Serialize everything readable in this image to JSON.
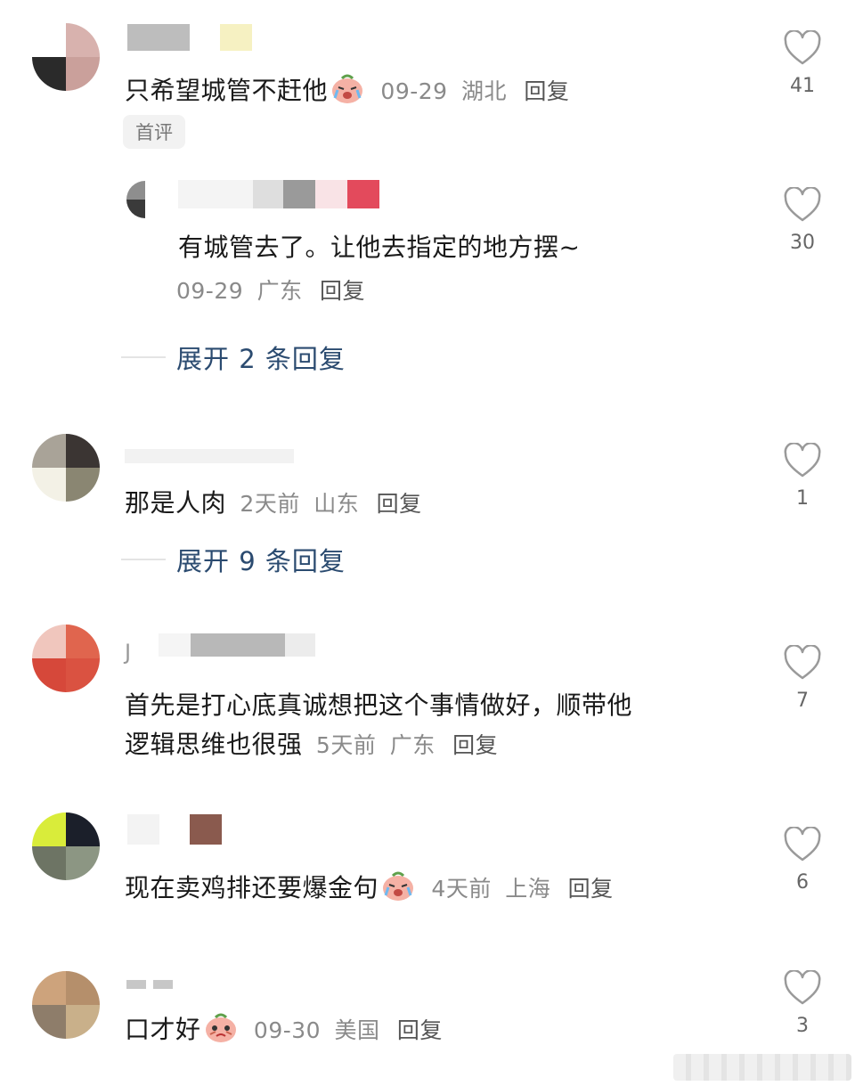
{
  "comments": [
    {
      "text": "只希望城管不赶他",
      "date": "09-29",
      "location": "湖北",
      "reply": "回复",
      "badge": "首评",
      "likes": "41",
      "emoji": "crying-face-icon"
    },
    {
      "text": "有城管去了。让他去指定的地方摆~",
      "date": "09-29",
      "location": "广东",
      "reply": "回复",
      "likes": "30",
      "expand": "展开 2 条回复"
    },
    {
      "text": "那是人肉",
      "date": "2天前",
      "location": "山东",
      "reply": "回复",
      "likes": "1",
      "expand": "展开 9 条回复"
    },
    {
      "author": "J",
      "text_line1": "首先是打心底真诚想把这个事情做好，顺带他",
      "text_line2": "逻辑思维也很强",
      "date": "5天前",
      "location": "广东",
      "reply": "回复",
      "likes": "7"
    },
    {
      "text": "现在卖鸡排还要爆金句",
      "date": "4天前",
      "location": "上海",
      "reply": "回复",
      "likes": "6",
      "emoji": "crying-face-icon"
    },
    {
      "text": "口才好",
      "date": "09-30",
      "location": "美国",
      "reply": "回复",
      "likes": "3",
      "emoji": "pleading-face-icon"
    }
  ],
  "colors": {
    "expand_link": "#2b4b70",
    "meta": "#8a8a8a",
    "heart_stroke": "#9a9a9a"
  }
}
